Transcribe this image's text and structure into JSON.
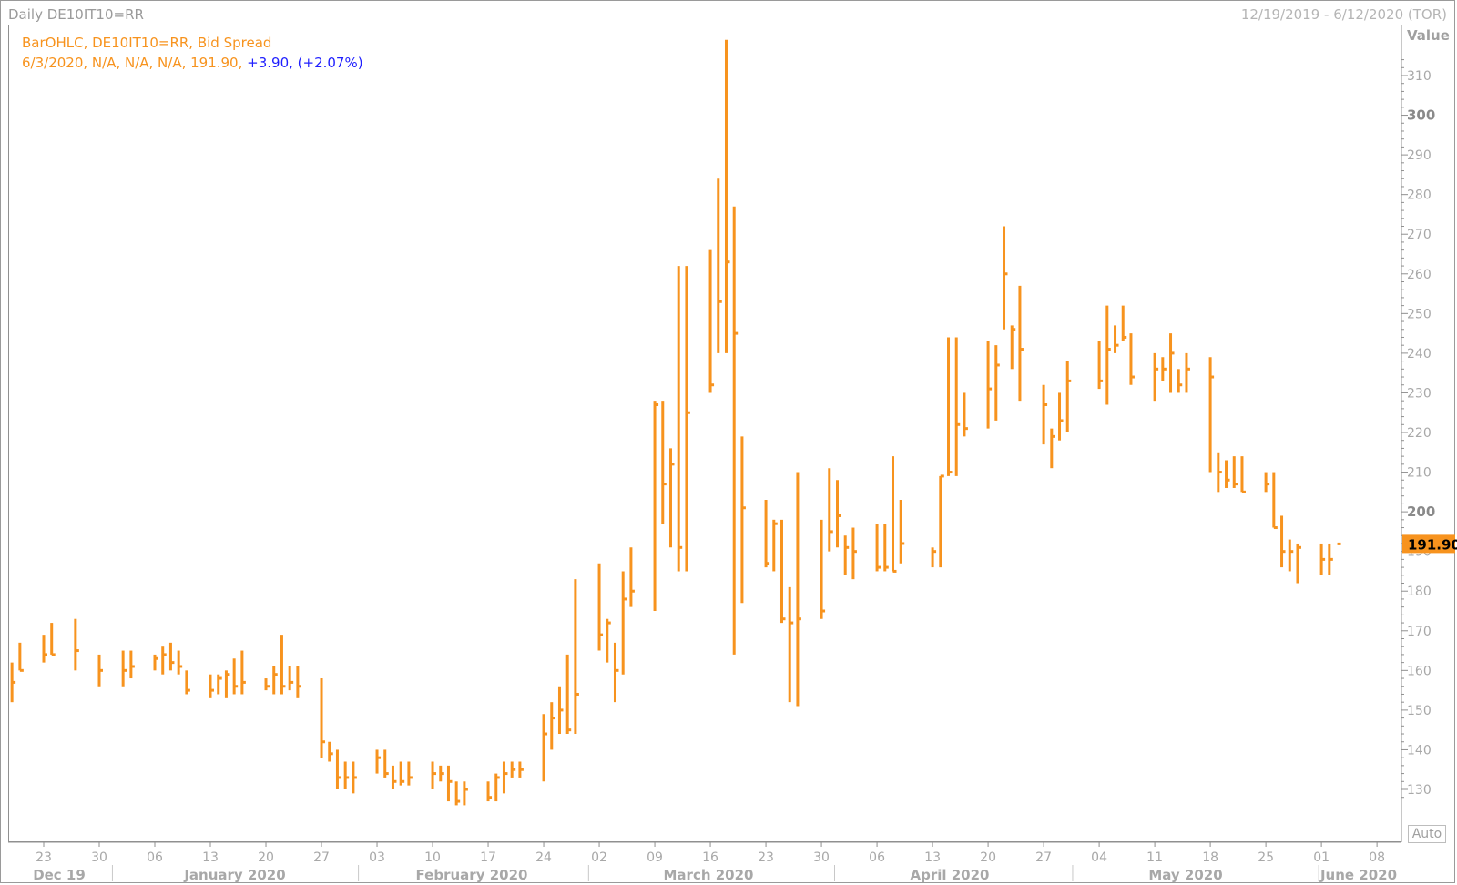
{
  "window": {
    "title": "Daily DE10IT10=RR",
    "date_range": "12/19/2019 - 6/12/2020 (TOR)"
  },
  "legend": {
    "line1": "BarOHLC, DE10IT10=RR, Bid Spread",
    "line2_prefix": "6/3/2020, N/A, N/A, N/A, 191.90, ",
    "line2_change": "+3.90, (+2.07%)"
  },
  "y_axis": {
    "label": "Value",
    "ticks": [
      "130",
      "140",
      "150",
      "160",
      "170",
      "180",
      "190",
      "200",
      "210",
      "220",
      "230",
      "240",
      "250",
      "260",
      "270",
      "280",
      "290",
      "300",
      "310"
    ],
    "last_value_label": "191.90"
  },
  "x_axis": {
    "day_ticks": [
      "23",
      "30",
      "06",
      "13",
      "20",
      "27",
      "03",
      "10",
      "17",
      "24",
      "02",
      "09",
      "16",
      "23",
      "30",
      "06",
      "13",
      "20",
      "27",
      "04",
      "11",
      "18",
      "25",
      "01",
      "08"
    ],
    "month_labels": [
      "Dec 19",
      "January 2020",
      "February 2020",
      "March 2020",
      "April 2020",
      "May 2020",
      "June 2020"
    ]
  },
  "auto_button": "Auto",
  "colors": {
    "bars": "#f7931e",
    "change_text": "#1f1fff",
    "last_value_box": "#f7931e"
  },
  "chart_data": {
    "type": "bar",
    "subtype": "ohlc",
    "title": "Daily DE10IT10=RR",
    "ylabel": "Value",
    "ylim": [
      123,
      319
    ],
    "grid": false,
    "last_value": 191.9,
    "series": [
      {
        "name": "DE10IT10=RR, Bid Spread",
        "points": [
          {
            "date": "2019-12-19",
            "high": 162,
            "low": 152,
            "close": 157
          },
          {
            "date": "2019-12-20",
            "high": 167,
            "low": 160,
            "close": 160
          },
          {
            "date": "2019-12-23",
            "high": 169,
            "low": 162,
            "close": 164
          },
          {
            "date": "2019-12-24",
            "high": 172,
            "low": 164,
            "close": 164
          },
          {
            "date": "2019-12-27",
            "high": 173,
            "low": 160,
            "close": 165
          },
          {
            "date": "2019-12-30",
            "high": 164,
            "low": 156,
            "close": 160
          },
          {
            "date": "2020-01-02",
            "high": 165,
            "low": 156,
            "close": 160
          },
          {
            "date": "2020-01-03",
            "high": 165,
            "low": 158,
            "close": 161
          },
          {
            "date": "2020-01-06",
            "high": 164,
            "low": 160,
            "close": 163
          },
          {
            "date": "2020-01-07",
            "high": 166,
            "low": 159,
            "close": 164
          },
          {
            "date": "2020-01-08",
            "high": 167,
            "low": 160,
            "close": 162
          },
          {
            "date": "2020-01-09",
            "high": 165,
            "low": 159,
            "close": 161
          },
          {
            "date": "2020-01-10",
            "high": 160,
            "low": 154,
            "close": 155
          },
          {
            "date": "2020-01-13",
            "high": 159,
            "low": 153,
            "close": 155
          },
          {
            "date": "2020-01-14",
            "high": 159,
            "low": 154,
            "close": 158
          },
          {
            "date": "2020-01-15",
            "high": 160,
            "low": 153,
            "close": 159
          },
          {
            "date": "2020-01-16",
            "high": 163,
            "low": 154,
            "close": 156
          },
          {
            "date": "2020-01-17",
            "high": 165,
            "low": 154,
            "close": 157
          },
          {
            "date": "2020-01-20",
            "high": 158,
            "low": 155,
            "close": 156
          },
          {
            "date": "2020-01-21",
            "high": 161,
            "low": 154,
            "close": 159
          },
          {
            "date": "2020-01-22",
            "high": 169,
            "low": 154,
            "close": 156
          },
          {
            "date": "2020-01-23",
            "high": 161,
            "low": 155,
            "close": 157
          },
          {
            "date": "2020-01-24",
            "high": 161,
            "low": 153,
            "close": 156
          },
          {
            "date": "2020-01-27",
            "high": 158,
            "low": 138,
            "close": 142
          },
          {
            "date": "2020-01-28",
            "high": 142,
            "low": 137,
            "close": 139
          },
          {
            "date": "2020-01-29",
            "high": 140,
            "low": 130,
            "close": 133
          },
          {
            "date": "2020-01-30",
            "high": 137,
            "low": 130,
            "close": 133
          },
          {
            "date": "2020-01-31",
            "high": 137,
            "low": 129,
            "close": 133
          },
          {
            "date": "2020-02-03",
            "high": 140,
            "low": 134,
            "close": 138
          },
          {
            "date": "2020-02-04",
            "high": 140,
            "low": 133,
            "close": 134
          },
          {
            "date": "2020-02-05",
            "high": 136,
            "low": 130,
            "close": 132
          },
          {
            "date": "2020-02-06",
            "high": 137,
            "low": 131,
            "close": 132
          },
          {
            "date": "2020-02-07",
            "high": 137,
            "low": 131,
            "close": 133
          },
          {
            "date": "2020-02-10",
            "high": 137,
            "low": 130,
            "close": 134
          },
          {
            "date": "2020-02-11",
            "high": 136,
            "low": 132,
            "close": 134
          },
          {
            "date": "2020-02-12",
            "high": 136,
            "low": 127,
            "close": 132
          },
          {
            "date": "2020-02-13",
            "high": 132,
            "low": 126,
            "close": 127
          },
          {
            "date": "2020-02-14",
            "high": 132,
            "low": 126,
            "close": 130
          },
          {
            "date": "2020-02-17",
            "high": 132,
            "low": 127,
            "close": 128
          },
          {
            "date": "2020-02-18",
            "high": 134,
            "low": 127,
            "close": 133
          },
          {
            "date": "2020-02-19",
            "high": 137,
            "low": 129,
            "close": 134
          },
          {
            "date": "2020-02-20",
            "high": 137,
            "low": 133,
            "close": 135
          },
          {
            "date": "2020-02-21",
            "high": 137,
            "low": 133,
            "close": 135
          },
          {
            "date": "2020-02-24",
            "high": 149,
            "low": 132,
            "close": 144
          },
          {
            "date": "2020-02-25",
            "high": 152,
            "low": 140,
            "close": 148
          },
          {
            "date": "2020-02-26",
            "high": 156,
            "low": 144,
            "close": 150
          },
          {
            "date": "2020-02-27",
            "high": 164,
            "low": 144,
            "close": 145
          },
          {
            "date": "2020-02-28",
            "high": 183,
            "low": 144,
            "close": 154
          },
          {
            "date": "2020-03-02",
            "high": 187,
            "low": 165,
            "close": 169
          },
          {
            "date": "2020-03-03",
            "high": 173,
            "low": 162,
            "close": 172
          },
          {
            "date": "2020-03-04",
            "high": 167,
            "low": 152,
            "close": 160
          },
          {
            "date": "2020-03-05",
            "high": 185,
            "low": 159,
            "close": 178
          },
          {
            "date": "2020-03-06",
            "high": 191,
            "low": 176,
            "close": 180
          },
          {
            "date": "2020-03-09",
            "high": 228,
            "low": 175,
            "close": 227
          },
          {
            "date": "2020-03-10",
            "high": 228,
            "low": 197,
            "close": 207
          },
          {
            "date": "2020-03-11",
            "high": 216,
            "low": 191,
            "close": 212
          },
          {
            "date": "2020-03-12",
            "high": 262,
            "low": 185,
            "close": 191
          },
          {
            "date": "2020-03-13",
            "high": 262,
            "low": 185,
            "close": 225
          },
          {
            "date": "2020-03-16",
            "high": 266,
            "low": 230,
            "close": 232
          },
          {
            "date": "2020-03-17",
            "high": 284,
            "low": 240,
            "close": 253
          },
          {
            "date": "2020-03-18",
            "high": 319,
            "low": 240,
            "close": 263
          },
          {
            "date": "2020-03-19",
            "high": 277,
            "low": 164,
            "close": 245
          },
          {
            "date": "2020-03-20",
            "high": 219,
            "low": 177,
            "close": 201
          },
          {
            "date": "2020-03-23",
            "high": 203,
            "low": 186,
            "close": 187
          },
          {
            "date": "2020-03-24",
            "high": 198,
            "low": 185,
            "close": 197
          },
          {
            "date": "2020-03-25",
            "high": 198,
            "low": 172,
            "close": 173
          },
          {
            "date": "2020-03-26",
            "high": 181,
            "low": 152,
            "close": 172
          },
          {
            "date": "2020-03-27",
            "high": 210,
            "low": 151,
            "close": 173
          },
          {
            "date": "2020-03-30",
            "high": 198,
            "low": 173,
            "close": 175
          },
          {
            "date": "2020-03-31",
            "high": 211,
            "low": 190,
            "close": 195
          },
          {
            "date": "2020-04-01",
            "high": 208,
            "low": 191,
            "close": 199
          },
          {
            "date": "2020-04-02",
            "high": 194,
            "low": 184,
            "close": 191
          },
          {
            "date": "2020-04-03",
            "high": 196,
            "low": 183,
            "close": 190
          },
          {
            "date": "2020-04-06",
            "high": 197,
            "low": 185,
            "close": 186
          },
          {
            "date": "2020-04-07",
            "high": 197,
            "low": 185,
            "close": 186
          },
          {
            "date": "2020-04-08",
            "high": 214,
            "low": 185,
            "close": 185
          },
          {
            "date": "2020-04-09",
            "high": 203,
            "low": 187,
            "close": 192
          },
          {
            "date": "2020-04-13",
            "high": 191,
            "low": 186,
            "close": 190
          },
          {
            "date": "2020-04-14",
            "high": 209,
            "low": 186,
            "close": 209
          },
          {
            "date": "2020-04-15",
            "high": 244,
            "low": 209,
            "close": 210
          },
          {
            "date": "2020-04-16",
            "high": 244,
            "low": 209,
            "close": 222
          },
          {
            "date": "2020-04-17",
            "high": 230,
            "low": 219,
            "close": 221
          },
          {
            "date": "2020-04-20",
            "high": 243,
            "low": 221,
            "close": 231
          },
          {
            "date": "2020-04-21",
            "high": 242,
            "low": 223,
            "close": 237
          },
          {
            "date": "2020-04-22",
            "high": 272,
            "low": 246,
            "close": 260
          },
          {
            "date": "2020-04-23",
            "high": 247,
            "low": 236,
            "close": 246
          },
          {
            "date": "2020-04-24",
            "high": 257,
            "low": 228,
            "close": 241
          },
          {
            "date": "2020-04-27",
            "high": 232,
            "low": 217,
            "close": 227
          },
          {
            "date": "2020-04-28",
            "high": 221,
            "low": 211,
            "close": 219
          },
          {
            "date": "2020-04-29",
            "high": 230,
            "low": 218,
            "close": 223
          },
          {
            "date": "2020-04-30",
            "high": 238,
            "low": 220,
            "close": 233
          },
          {
            "date": "2020-05-04",
            "high": 243,
            "low": 231,
            "close": 233
          },
          {
            "date": "2020-05-05",
            "high": 252,
            "low": 227,
            "close": 241
          },
          {
            "date": "2020-05-06",
            "high": 247,
            "low": 240,
            "close": 242
          },
          {
            "date": "2020-05-07",
            "high": 252,
            "low": 243,
            "close": 244
          },
          {
            "date": "2020-05-08",
            "high": 245,
            "low": 232,
            "close": 234
          },
          {
            "date": "2020-05-11",
            "high": 240,
            "low": 228,
            "close": 236
          },
          {
            "date": "2020-05-12",
            "high": 239,
            "low": 233,
            "close": 236
          },
          {
            "date": "2020-05-13",
            "high": 245,
            "low": 230,
            "close": 240
          },
          {
            "date": "2020-05-14",
            "high": 236,
            "low": 230,
            "close": 232
          },
          {
            "date": "2020-05-15",
            "high": 240,
            "low": 230,
            "close": 236
          },
          {
            "date": "2020-05-18",
            "high": 239,
            "low": 210,
            "close": 234
          },
          {
            "date": "2020-05-19",
            "high": 215,
            "low": 205,
            "close": 210
          },
          {
            "date": "2020-05-20",
            "high": 213,
            "low": 206,
            "close": 208
          },
          {
            "date": "2020-05-21",
            "high": 214,
            "low": 206,
            "close": 207
          },
          {
            "date": "2020-05-22",
            "high": 214,
            "low": 205,
            "close": 205
          },
          {
            "date": "2020-05-25",
            "high": 210,
            "low": 205,
            "close": 207
          },
          {
            "date": "2020-05-26",
            "high": 210,
            "low": 196,
            "close": 196
          },
          {
            "date": "2020-05-27",
            "high": 199,
            "low": 186,
            "close": 190
          },
          {
            "date": "2020-05-28",
            "high": 193,
            "low": 185,
            "close": 190
          },
          {
            "date": "2020-05-29",
            "high": 192,
            "low": 182,
            "close": 191
          },
          {
            "date": "2020-06-01",
            "high": 192,
            "low": 184,
            "close": 188
          },
          {
            "date": "2020-06-02",
            "high": 192,
            "low": 184,
            "close": 188
          },
          {
            "date": "2020-06-03",
            "high": 192,
            "low": 192,
            "close": 191.9
          }
        ]
      }
    ]
  }
}
